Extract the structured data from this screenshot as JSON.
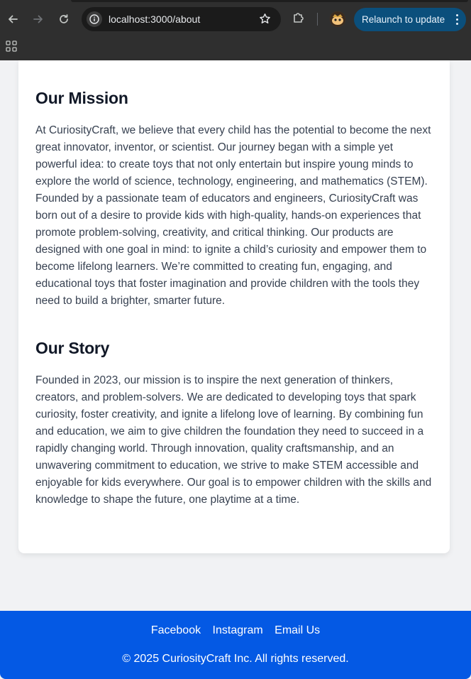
{
  "browser": {
    "url": "localhost:3000/about",
    "relaunch_label": "Relaunch to update"
  },
  "mission": {
    "title": "Our Mission",
    "body": "At CuriosityCraft, we believe that every child has the potential to become the next great innovator, inventor, or scientist. Our journey began with a simple yet powerful idea: to create toys that not only entertain but inspire young minds to explore the world of science, technology, engineering, and mathematics (STEM). Founded by a passionate team of educators and engineers, CuriosityCraft was born out of a desire to provide kids with high-quality, hands-on experiences that promote problem-solving, creativity, and critical thinking. Our products are designed with one goal in mind: to ignite a child’s curiosity and empower them to become lifelong learners. We’re committed to creating fun, engaging, and educational toys that foster imagination and provide children with the tools they need to build a brighter, smarter future."
  },
  "story": {
    "title": "Our Story",
    "body": "Founded in 2023, our mission is to inspire the next generation of thinkers, creators, and problem-solvers. We are dedicated to developing toys that spark curiosity, foster creativity, and ignite a lifelong love of learning. By combining fun and education, we aim to give children the foundation they need to succeed in a rapidly changing world. Through innovation, quality craftsmanship, and an unwavering commitment to education, we strive to make STEM accessible and enjoyable for kids everywhere. Our goal is to empower children with the skills and knowledge to shape the future, one playtime at a time."
  },
  "footer": {
    "links": [
      "Facebook",
      "Instagram",
      "Email Us"
    ],
    "copyright": "© 2025 CuriosityCraft Inc. All rights reserved."
  },
  "colors": {
    "footer_bg": "#0459e4",
    "relaunch_bg": "#0b4f7c"
  }
}
